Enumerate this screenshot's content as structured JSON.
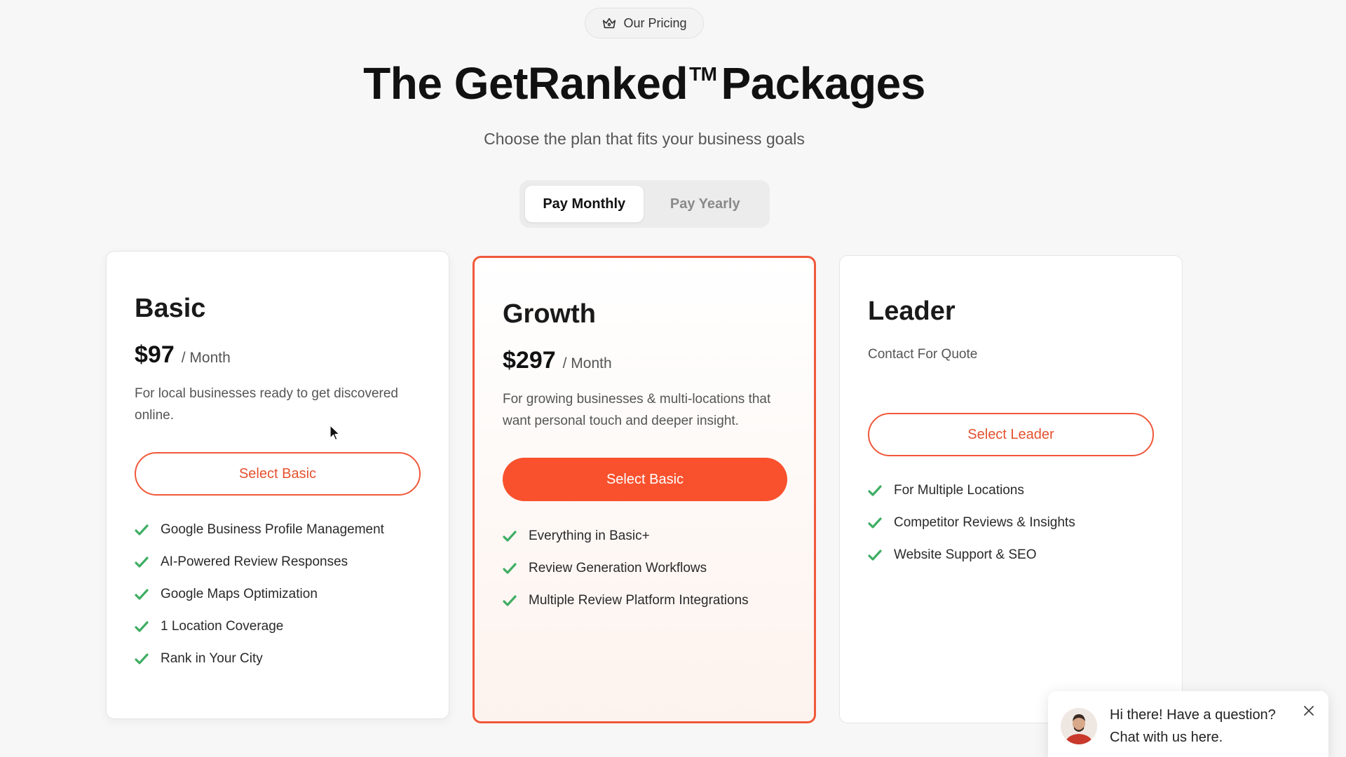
{
  "header": {
    "badge_label": "Our Pricing",
    "badge_icon": "crown-icon",
    "title_part1": "The GetRanked",
    "title_tm": "TM",
    "title_part2": "Packages",
    "subtitle": "Choose the plan that fits your business goals"
  },
  "billing_toggle": {
    "options": [
      "Pay Monthly",
      "Pay Yearly"
    ],
    "selected": "Pay Monthly"
  },
  "plans": [
    {
      "name": "Basic",
      "price": "$97",
      "period": "/ Month",
      "description": "For local businesses ready to get discovered online.",
      "button_label": "Select Basic",
      "features": [
        "Google Business Profile Management",
        "AI-Powered Review Responses",
        "Google Maps Optimization",
        "1 Location Coverage",
        "Rank in Your City"
      ]
    },
    {
      "name": "Growth",
      "price": "$297",
      "period": "/ Month",
      "description": "For growing businesses & multi-locations that want personal touch and deeper insight.",
      "button_label": "Select Basic",
      "features": [
        "Everything in Basic+",
        "Review Generation Workflows",
        "Multiple Review Platform Integrations"
      ]
    },
    {
      "name": "Leader",
      "quote_text": "Contact For Quote",
      "button_label": "Select Leader",
      "features": [
        "For Multiple Locations",
        "Competitor Reviews & Insights",
        "Website Support & SEO"
      ]
    }
  ],
  "chat_widget": {
    "line1": "Hi there! Have a question?",
    "line2": "Chat with us here."
  },
  "colors": {
    "accent": "#f9512d",
    "check_green": "#3fae63",
    "background": "#f7f7f7"
  }
}
